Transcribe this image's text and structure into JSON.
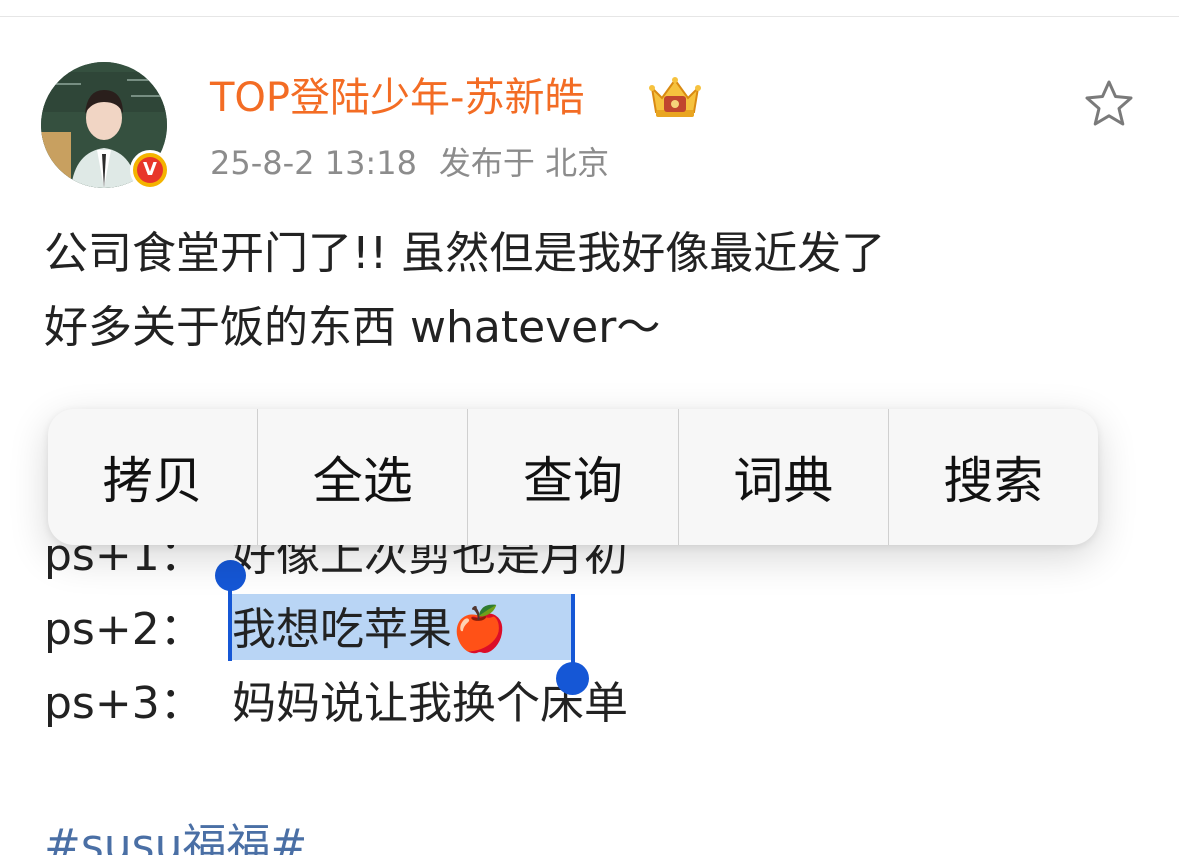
{
  "post": {
    "username": "TOP登陆少年-苏新皓",
    "timestamp": "25-8-2 13:18",
    "location": "发布于 北京",
    "verified_badge": "V",
    "body_line1": "公司食堂开门了!! 虽然但是我好像最近发了",
    "body_line2": "好多关于饭的东西 whatever～",
    "ps": [
      {
        "label": "ps+1：",
        "text": "好像上次剪也是月初"
      },
      {
        "label": "ps+2：",
        "text": "我想吃苹果🍎"
      },
      {
        "label": "ps+3：",
        "text": "妈妈说让我换个床单"
      }
    ],
    "hashtag": "#susu福福#"
  },
  "context_menu": {
    "items": [
      {
        "label": "拷贝"
      },
      {
        "label": "全选"
      },
      {
        "label": "查询"
      },
      {
        "label": "词典"
      },
      {
        "label": "搜索"
      }
    ]
  },
  "colors": {
    "username": "#f36c24",
    "selection": "#b9d5f5",
    "selection_handle": "#1557d6",
    "meta": "#8c8c8c",
    "hashtag": "#4a6fa5"
  },
  "icons": [
    "avatar",
    "verified-badge-icon",
    "crown-badge-icon",
    "star-icon"
  ]
}
